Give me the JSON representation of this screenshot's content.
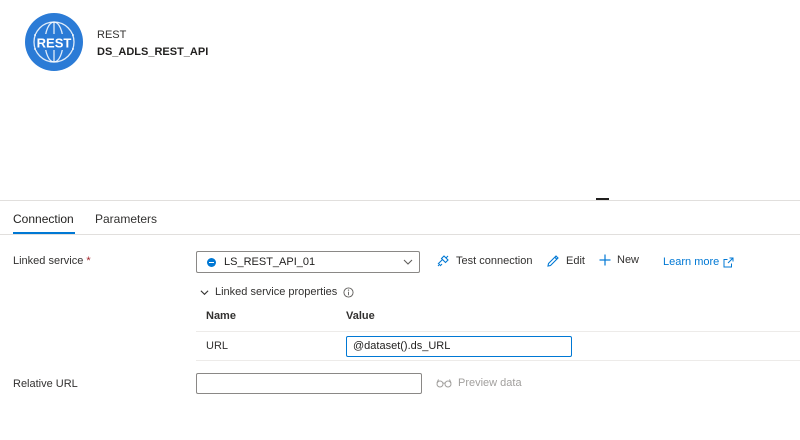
{
  "header": {
    "logo_text": "REST",
    "type_label": "REST",
    "dataset_name": "DS_ADLS_REST_API"
  },
  "tabs": [
    {
      "label": "Connection",
      "active": true
    },
    {
      "label": "Parameters",
      "active": false
    }
  ],
  "connection": {
    "linked_service": {
      "label": "Linked service",
      "required_mark": "*",
      "selected_value": "LS_REST_API_01"
    },
    "actions": {
      "test_connection": "Test connection",
      "edit": "Edit",
      "new": "New",
      "learn_more": "Learn more"
    },
    "linked_service_properties": {
      "title": "Linked service properties",
      "columns": [
        "Name",
        "Value"
      ],
      "rows": [
        {
          "name": "URL",
          "value": "@dataset().ds_URL"
        }
      ]
    },
    "relative_url": {
      "label": "Relative URL",
      "value": "",
      "preview_label": "Preview data"
    }
  },
  "colors": {
    "accent": "#0078d4",
    "logo_bg": "#2b7bd6",
    "required": "#a4262c",
    "disabled_text": "#a19f9d"
  }
}
